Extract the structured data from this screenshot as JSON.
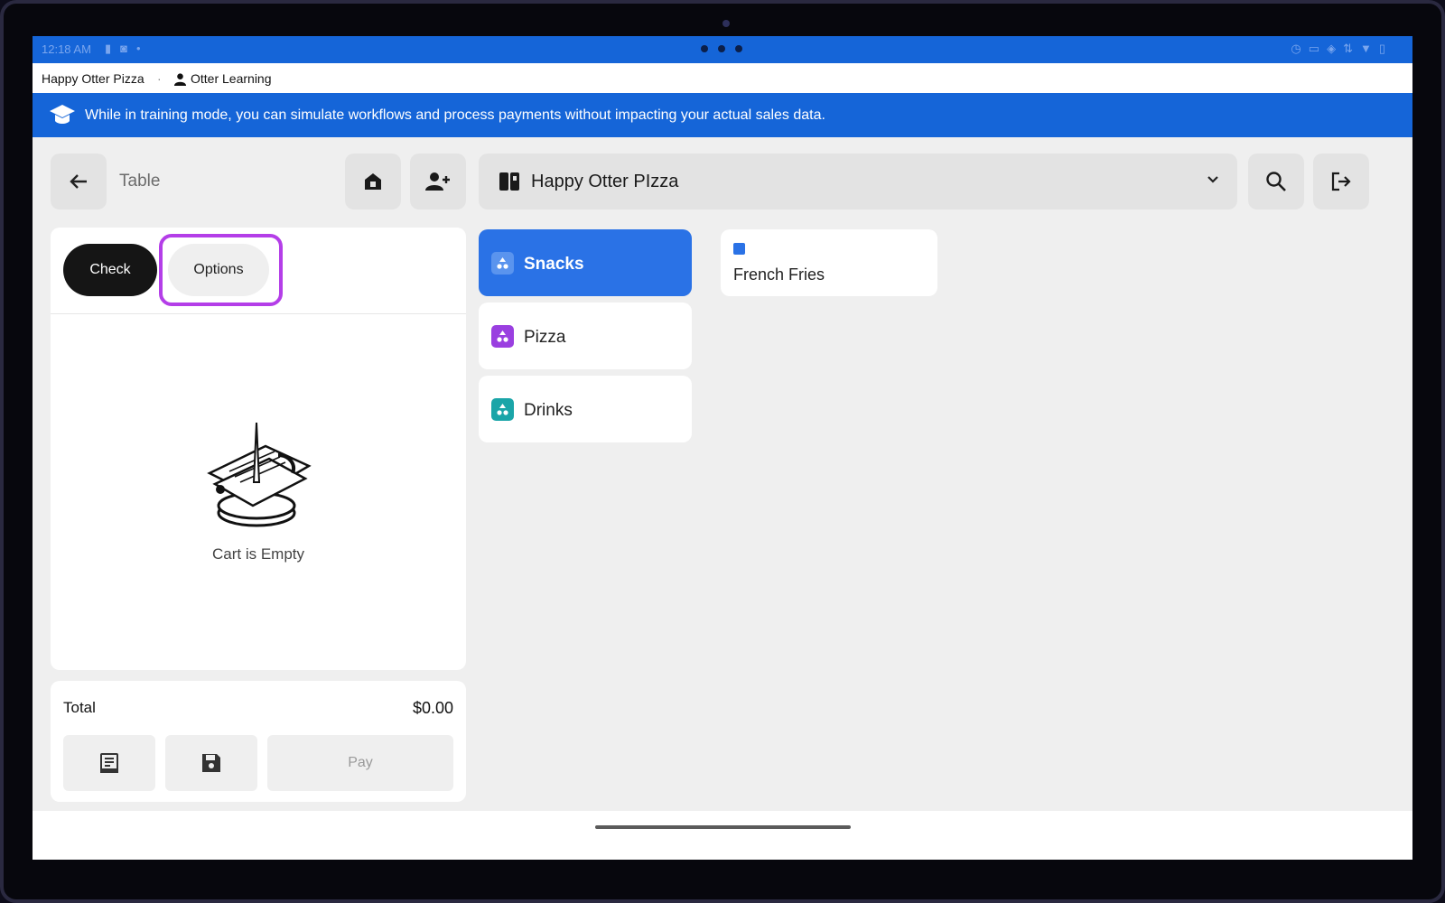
{
  "status_bar": {
    "time": "12:18 AM",
    "left_icons": [
      "battery-icon",
      "notification-icon",
      "dot-icon"
    ],
    "right_icons": [
      "alarm-icon",
      "cast-icon",
      "vibrate-icon",
      "signal-icon",
      "wifi-icon",
      "battery-icon"
    ]
  },
  "header": {
    "store_name": "Happy Otter Pizza",
    "separator": "·",
    "user_name": "Otter Learning"
  },
  "banner": {
    "text": "While in training mode, you can simulate workflows and process payments without impacting your actual sales data."
  },
  "toolbar": {
    "table_label": "Table",
    "store_selector": "Happy Otter PIzza"
  },
  "cart": {
    "tabs": {
      "check": "Check",
      "options": "Options"
    },
    "empty_text": "Cart is Empty",
    "total_label": "Total",
    "total_value": "$0.00",
    "pay_label": "Pay"
  },
  "categories": [
    {
      "label": "Snacks",
      "color": "#2a72e6",
      "active": true
    },
    {
      "label": "Pizza",
      "color": "#9a3fe0",
      "active": false
    },
    {
      "label": "Drinks",
      "color": "#1aa5a8",
      "active": false
    }
  ],
  "items": [
    {
      "name": "French Fries",
      "color": "#2a72e6"
    }
  ],
  "colors": {
    "accent": "#1565d8",
    "highlight": "#b43ee8"
  }
}
